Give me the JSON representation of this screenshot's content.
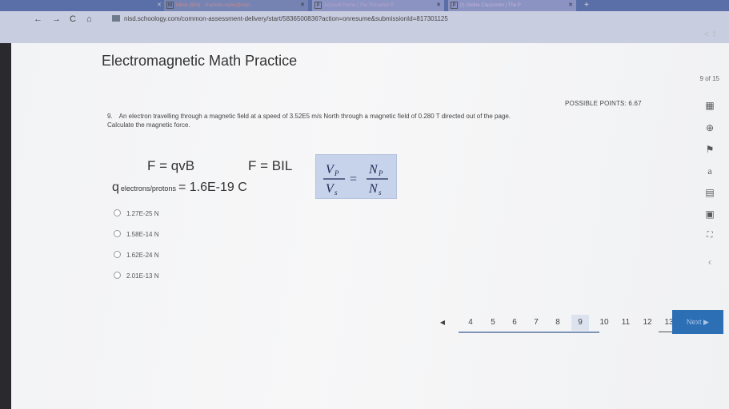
{
  "browser": {
    "tabs": [
      {
        "icon": "gmail-icon",
        "label": "Inbox (924) - charlotte.taylor@nisd..."
      },
      {
        "icon": "p-icon",
        "label": "Account Home | The Princeton R"
      },
      {
        "icon": "p-icon",
        "label": "(I) Online Classroom | The P"
      }
    ],
    "url": "nisd.schoology.com/common-assessment-delivery/start/5836500836?action=onresume&submissionId=817301125"
  },
  "page": {
    "title": "Electromagnetic Math Practice",
    "counter": "9 of 15",
    "points": "POSSIBLE POINTS: 6.67",
    "question": {
      "number": "9.",
      "line1": "An electron travelling through a magnetic field at a speed of 3.52E5 m/s North through a magnetic field of 0.280 T directed out of the page.",
      "line2": "Calculate the magnetic force."
    },
    "formulas": {
      "f1": "F = qvB",
      "f2": "F = BIL",
      "charge_q": "q",
      "charge_sub": "electrons/protons",
      "charge_val": "= 1.6E-19 C",
      "ratio": {
        "vp": "V",
        "vp_sub": "P",
        "vs": "V",
        "vs_sub": "s",
        "np": "N",
        "np_sub": "P",
        "ns": "N",
        "ns_sub": "s",
        "eq": "="
      }
    },
    "options": [
      "1.27E-25 N",
      "1.58E-14 N",
      "1.62E-24 N",
      "2.01E-13 N"
    ],
    "pager": {
      "pages": [
        "4",
        "5",
        "6",
        "7",
        "8",
        "9",
        "10",
        "11",
        "12",
        "13"
      ],
      "active": "9",
      "next_label": "Next"
    },
    "sidebar_icons": [
      "calculator-icon",
      "plus-circle-icon",
      "flag-icon",
      "text-size-icon",
      "notes-icon",
      "reference-icon",
      "fullscreen-icon",
      "collapse-icon"
    ]
  },
  "colors": {
    "accent": "#2c6fb4",
    "formula_box": "#c6d3ea"
  }
}
